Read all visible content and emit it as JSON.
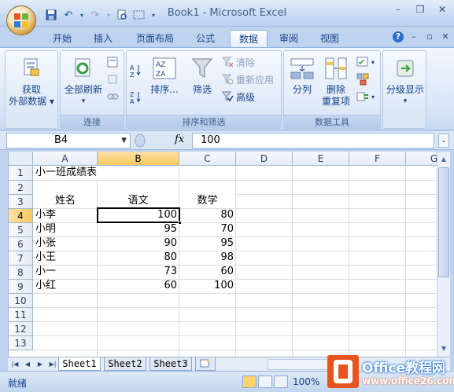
{
  "window": {
    "title": "Book1 - Microsoft Excel"
  },
  "tabs": [
    {
      "label": "开始",
      "active": false
    },
    {
      "label": "插入",
      "active": false
    },
    {
      "label": "页面布局",
      "active": false
    },
    {
      "label": "公式",
      "active": false
    },
    {
      "label": "数据",
      "active": true
    },
    {
      "label": "审阅",
      "active": false
    },
    {
      "label": "视图",
      "active": false
    }
  ],
  "ribbon": {
    "get_external": {
      "label1": "获取",
      "label2": "外部数据"
    },
    "connections": {
      "refresh_all": "全部刷新",
      "group_label": "连接"
    },
    "sort_filter": {
      "sort": "排序...",
      "filter": "筛选",
      "clear": "清除",
      "reapply": "重新应用",
      "advanced": "高级",
      "group_label": "排序和筛选"
    },
    "data_tools": {
      "split": "分列",
      "remove_dup1": "删除",
      "remove_dup2": "重复项",
      "group_label": "数据工具"
    },
    "outline": {
      "label": "分级显示"
    }
  },
  "formula_bar": {
    "name_box": "B4",
    "fx": "fx",
    "value": "100"
  },
  "columns": [
    "A",
    "B",
    "C",
    "D",
    "E",
    "F",
    "G"
  ],
  "rows": [
    "1",
    "2",
    "3",
    "4",
    "5",
    "6",
    "7",
    "8",
    "9",
    "10",
    "11",
    "12",
    "13"
  ],
  "sheet": {
    "title": "小一班成绩表",
    "headers": {
      "name": "姓名",
      "chinese": "语文",
      "math": "数学"
    },
    "records": [
      {
        "name": "小李",
        "chinese": "100",
        "math": "80"
      },
      {
        "name": "小明",
        "chinese": "95",
        "math": "70"
      },
      {
        "name": "小张",
        "chinese": "90",
        "math": "95"
      },
      {
        "name": "小王",
        "chinese": "80",
        "math": "98"
      },
      {
        "name": "小一",
        "chinese": "73",
        "math": "60"
      },
      {
        "name": "小红",
        "chinese": "60",
        "math": "100"
      }
    ]
  },
  "sheet_tabs": [
    {
      "label": "Sheet1",
      "active": true
    },
    {
      "label": "Sheet2",
      "active": false
    },
    {
      "label": "Sheet3",
      "active": false
    }
  ],
  "status": {
    "ready": "就绪",
    "zoom": "100%"
  },
  "watermark": {
    "line1": "Office教程网",
    "line2": "www.office26.com"
  },
  "colors": {
    "accent": "#15428b",
    "selected_header": "#f9c75e",
    "ribbon_bg": "#dbe7f7"
  }
}
